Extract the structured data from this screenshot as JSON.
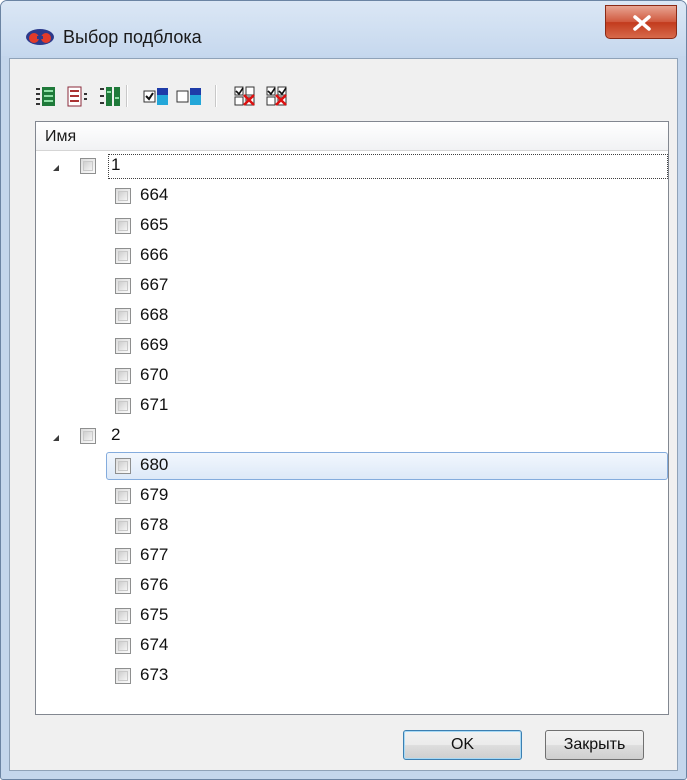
{
  "window": {
    "title": "Выбор подблока",
    "close_glyph": "X",
    "app_icon": "stereo-glasses-icon"
  },
  "toolbar": {
    "buttons": [
      {
        "name": "expand-all-icon",
        "tooltip": ""
      },
      {
        "name": "collapse-all-icon",
        "tooltip": ""
      },
      {
        "name": "expand-checked-icon",
        "tooltip": ""
      },
      {
        "name": "check-all-icon",
        "tooltip": ""
      },
      {
        "name": "uncheck-all-icon",
        "tooltip": ""
      },
      {
        "name": "check-selected-icon",
        "tooltip": ""
      },
      {
        "name": "uncheck-selected-icon",
        "tooltip": ""
      }
    ]
  },
  "tree": {
    "column_header": "Имя",
    "groups": [
      {
        "label": "1",
        "expanded": true,
        "checked": false,
        "items": [
          "664",
          "665",
          "666",
          "667",
          "668",
          "669",
          "670",
          "671"
        ]
      },
      {
        "label": "2",
        "expanded": true,
        "checked": false,
        "items": [
          "680",
          "679",
          "678",
          "677",
          "676",
          "675",
          "674",
          "673"
        ]
      }
    ],
    "selected_item": "680",
    "focused_item": "1"
  },
  "buttons": {
    "ok": "OK",
    "close": "Закрыть"
  },
  "colors": {
    "selection_border": "#84acdd",
    "close_button": "#c23a1d",
    "frame": "#c4d6ec"
  }
}
